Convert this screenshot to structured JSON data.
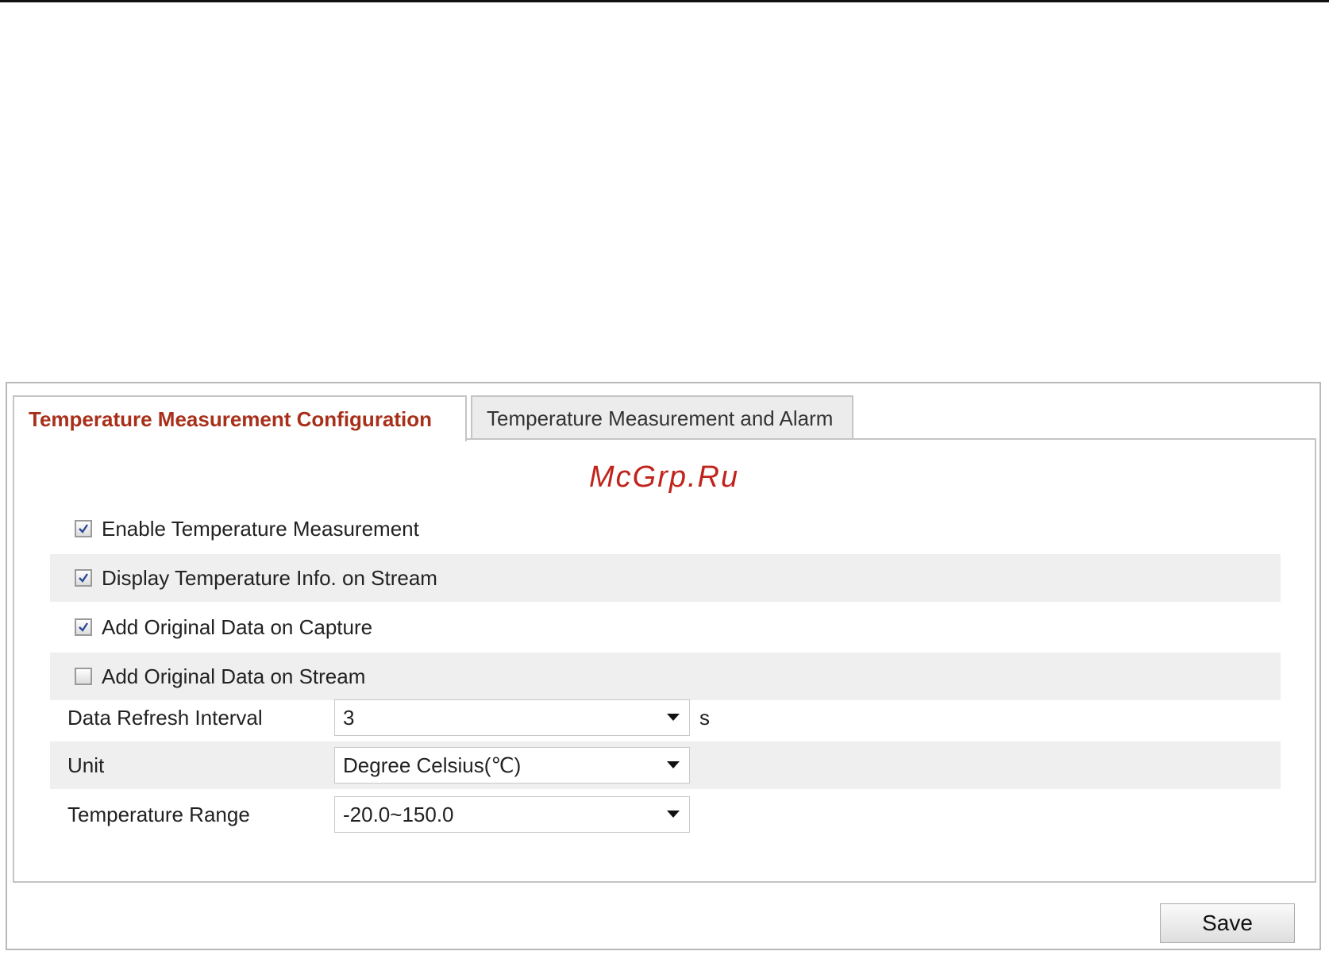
{
  "tabs": [
    {
      "label": "Temperature Measurement Configuration",
      "active": true
    },
    {
      "label": "Temperature Measurement and Alarm",
      "active": false
    }
  ],
  "watermark": "McGrp.Ru",
  "options": [
    {
      "label": "Enable Temperature Measurement",
      "checked": true
    },
    {
      "label": "Display Temperature Info. on Stream",
      "checked": true
    },
    {
      "label": "Add Original Data on Capture",
      "checked": true
    },
    {
      "label": "Add Original Data on Stream",
      "checked": false
    }
  ],
  "fields": {
    "refresh_interval": {
      "label": "Data Refresh Interval",
      "value": "3",
      "suffix": "s"
    },
    "unit": {
      "label": "Unit",
      "value": "Degree Celsius(℃)"
    },
    "temp_range": {
      "label": "Temperature Range",
      "value": "-20.0~150.0"
    }
  },
  "save_label": "Save",
  "colors": {
    "active_tab": "#a8301a",
    "row_shade": "#efefef",
    "watermark": "#c0241c"
  }
}
